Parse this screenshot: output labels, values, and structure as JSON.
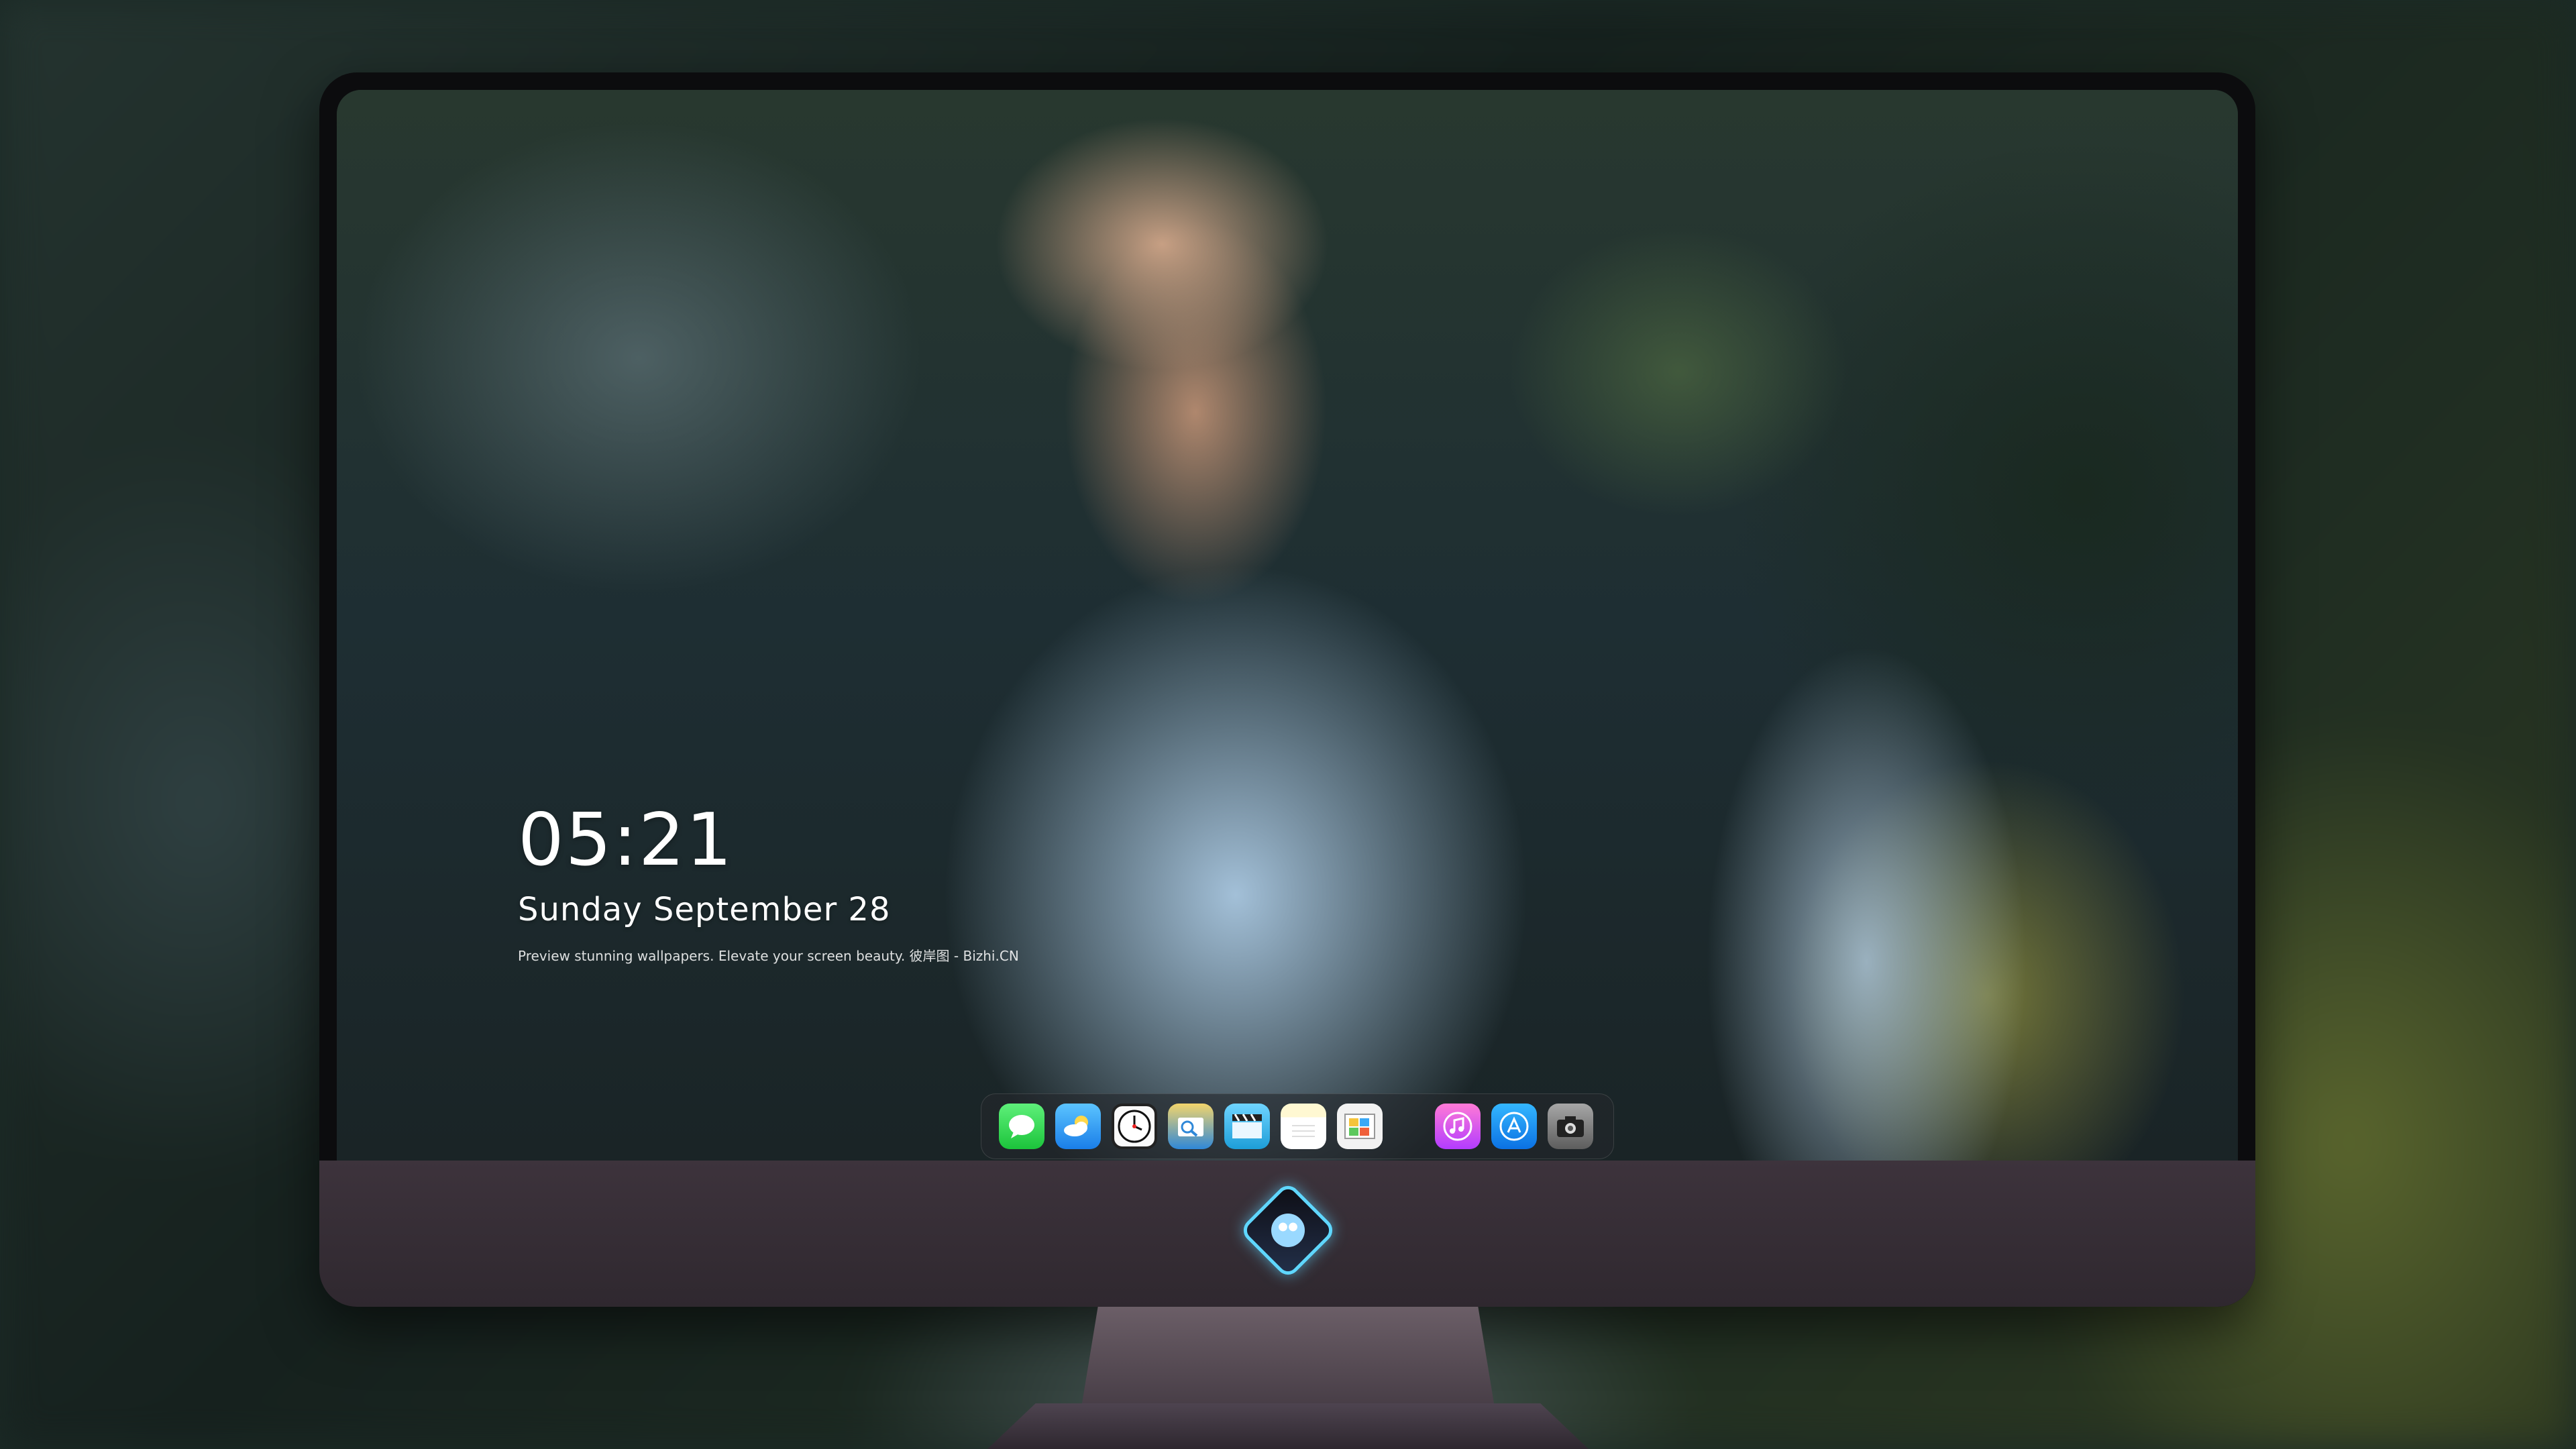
{
  "lock_screen": {
    "time": "05:21",
    "date": "Sunday September  28",
    "caption": "Preview stunning wallpapers. Elevate your screen beauty. 彼岸图 - Bizhi.CN"
  },
  "dock": {
    "apps": [
      {
        "name": "Messages",
        "icon": "messages-icon"
      },
      {
        "name": "Weather",
        "icon": "weather-icon"
      },
      {
        "name": "Clock",
        "icon": "clock-icon"
      },
      {
        "name": "Preview",
        "icon": "preview-icon"
      },
      {
        "name": "Clips",
        "icon": "clips-icon"
      },
      {
        "name": "Notes",
        "icon": "notes-icon"
      },
      {
        "name": "Photos",
        "icon": "photos-icon"
      },
      {
        "name": "Music",
        "icon": "music-icon"
      },
      {
        "name": "App Store",
        "icon": "app-store-icon"
      },
      {
        "name": "Camera",
        "icon": "camera-icon"
      }
    ]
  },
  "device": {
    "logo_icon": "brand-logo-icon"
  },
  "colors": {
    "bezel": "#0c0c0e",
    "chin": "#3d333c",
    "logo_glow": "#5fd7ff",
    "text": "#ffffff"
  }
}
